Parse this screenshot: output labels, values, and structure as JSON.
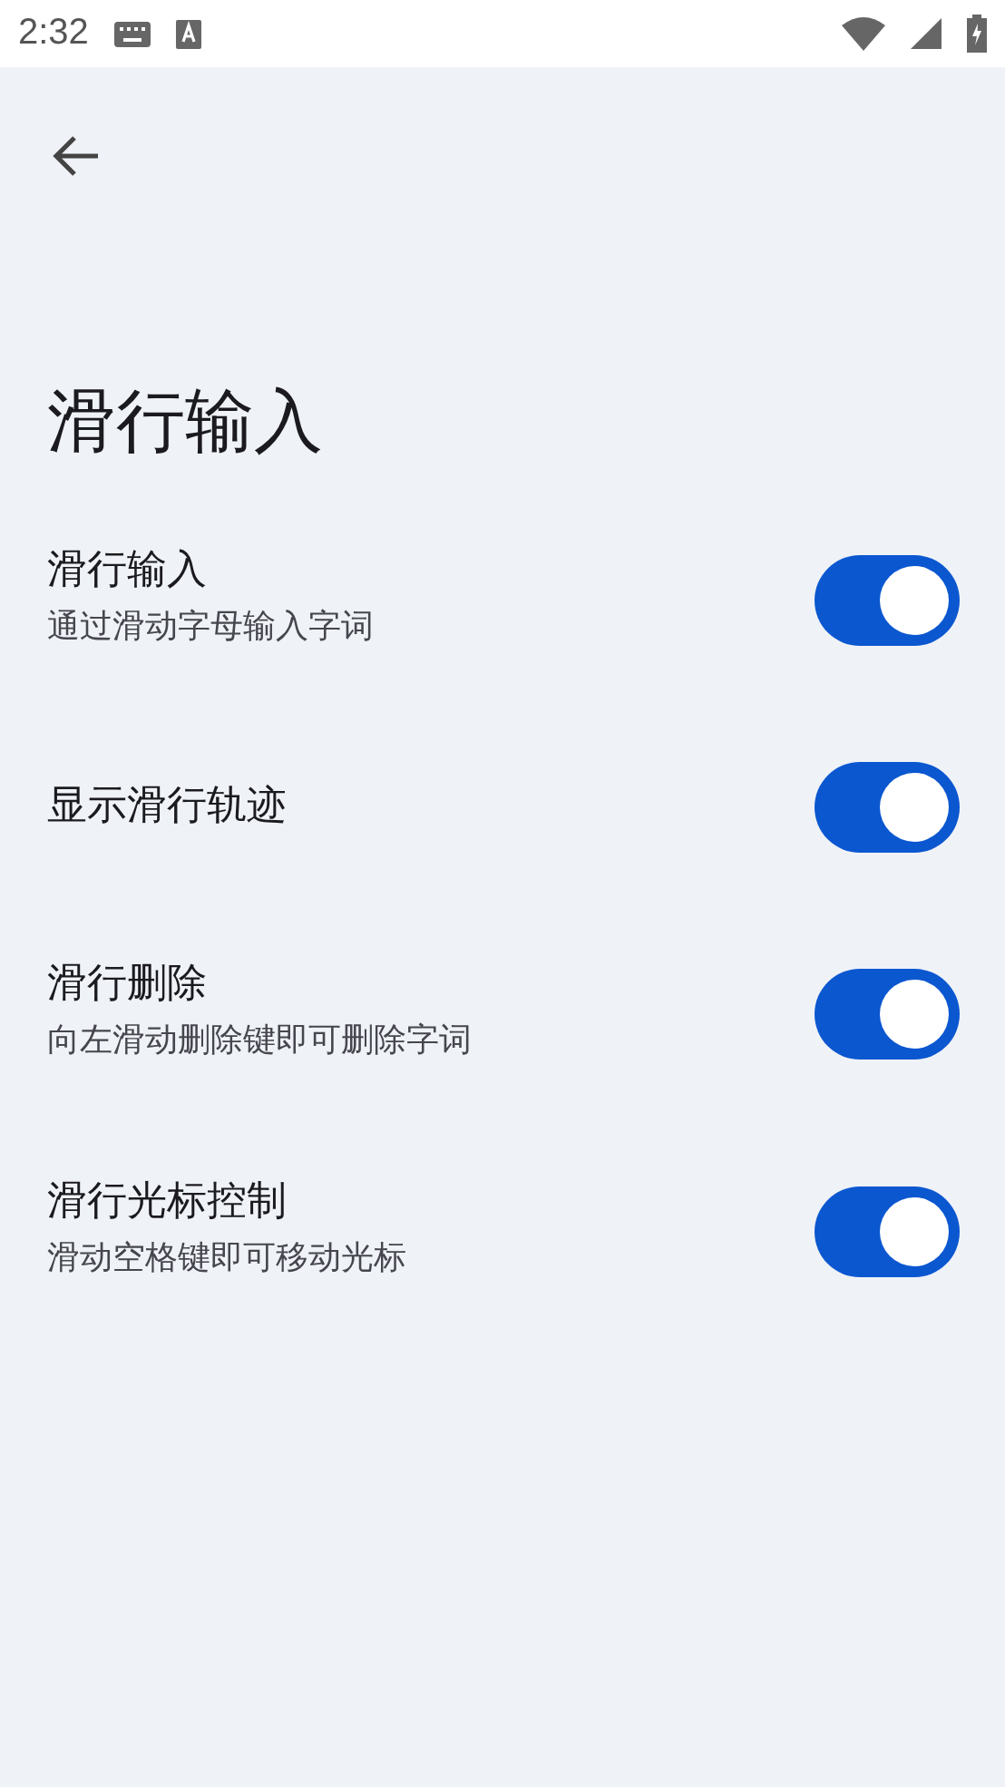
{
  "status_bar": {
    "time": "2:32"
  },
  "title": "滑行输入",
  "settings": [
    {
      "title": "滑行输入",
      "subtitle": "通过滑动字母输入字词",
      "on": true
    },
    {
      "title": "显示滑行轨迹",
      "on": true
    },
    {
      "title": "滑行删除",
      "subtitle": "向左滑动删除键即可删除字词",
      "on": true
    },
    {
      "title": "滑行光标控制",
      "subtitle": "滑动空格键即可移动光标",
      "on": true
    }
  ]
}
